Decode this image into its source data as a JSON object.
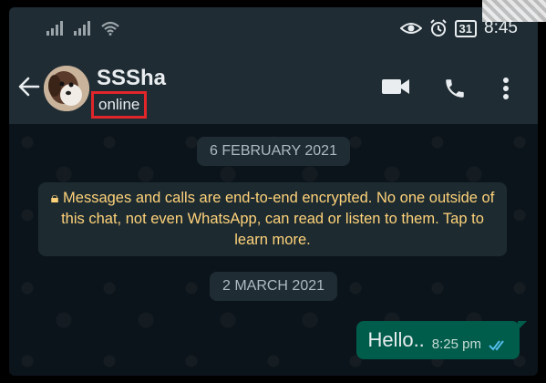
{
  "status_bar": {
    "time": "8:45",
    "battery": "31"
  },
  "header": {
    "contact_name": "SSSha",
    "status": "online"
  },
  "chat": {
    "date_chip_1": "6 FEBRUARY 2021",
    "encryption_notice": "Messages and calls are end-to-end encrypted. No one outside of this chat, not even WhatsApp, can read or listen to them. Tap to learn more.",
    "date_chip_2": "2 MARCH 2021",
    "messages": [
      {
        "text": "Hello..",
        "time": "8:25 pm",
        "direction": "outgoing",
        "ticks": "read"
      }
    ]
  },
  "colors": {
    "header_bg": "#1f2c34",
    "chat_bg": "#0b141a",
    "outgoing_bubble": "#005c4b",
    "encryption_text": "#ffd279",
    "read_tick": "#53bdeb",
    "highlight_box": "#e0262b"
  }
}
